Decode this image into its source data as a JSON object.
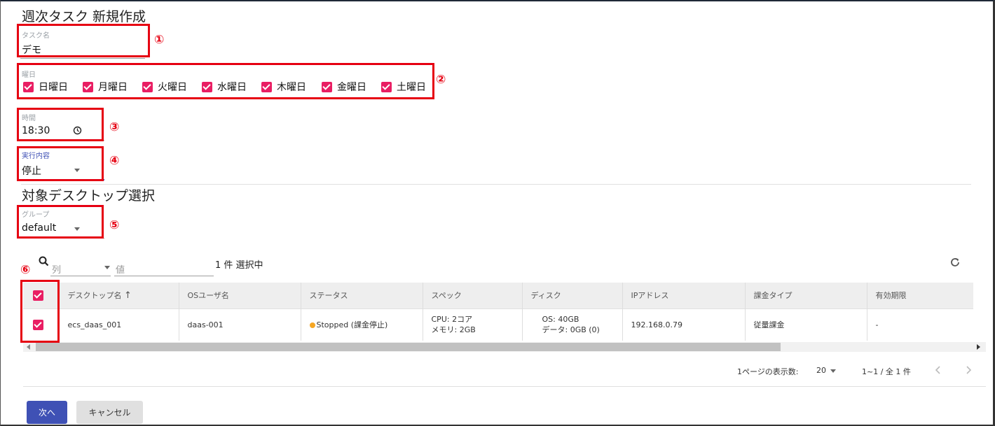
{
  "page": {
    "title": "週次タスク 新規作成"
  },
  "task_name": {
    "label": "タスク名",
    "value": "デモ"
  },
  "weekdays": {
    "label": "曜日",
    "items": [
      {
        "label": "日曜日",
        "checked": true
      },
      {
        "label": "月曜日",
        "checked": true
      },
      {
        "label": "火曜日",
        "checked": true
      },
      {
        "label": "水曜日",
        "checked": true
      },
      {
        "label": "木曜日",
        "checked": true
      },
      {
        "label": "金曜日",
        "checked": true
      },
      {
        "label": "土曜日",
        "checked": true
      }
    ]
  },
  "time": {
    "label": "時間",
    "value": "18:30"
  },
  "action": {
    "label": "実行内容",
    "value": "停止"
  },
  "target": {
    "title": "対象デスクトップ選択"
  },
  "group": {
    "label": "グループ",
    "value": "default"
  },
  "filter": {
    "column_placeholder": "列",
    "value_placeholder": "値",
    "selected_count": "1 件 選択中"
  },
  "table": {
    "columns": [
      "デスクトップ名",
      "OSユーザ名",
      "ステータス",
      "スペック",
      "ディスク",
      "IPアドレス",
      "課金タイプ",
      "有効期限"
    ],
    "sort_arrow": "↑",
    "rows": [
      {
        "name": "ecs_daas_001",
        "os_user": "daas-001",
        "status": "Stopped (課金停止)",
        "spec_cpu": "CPU: 2コア",
        "spec_mem": "メモリ: 2GB",
        "disk_os": "OS: 40GB",
        "disk_data": "データ: 0GB (0)",
        "ip": "192.168.0.79",
        "billing": "従量課金",
        "expiry": "-"
      }
    ]
  },
  "pagination": {
    "per_page_label": "1ページの表示数:",
    "per_page_value": "20",
    "range": "1~1 / 全 1 件"
  },
  "annotations": [
    "①",
    "②",
    "③",
    "④",
    "⑤",
    "⑥"
  ],
  "buttons": {
    "next": "次へ",
    "cancel": "キャンセル"
  },
  "colors": {
    "checkbox": "#e91e63",
    "primary": "#3f51b5",
    "highlight": "#e60012",
    "status_stopped": "#f5a623"
  }
}
